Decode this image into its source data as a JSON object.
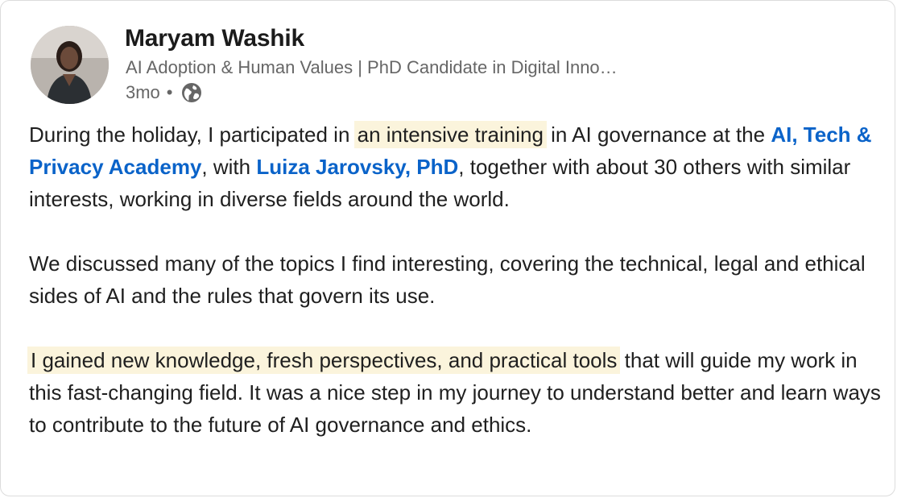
{
  "author": {
    "name": "Maryam Washik",
    "headline": "AI Adoption & Human Values | PhD Candidate in Digital Inno…",
    "time": "3mo",
    "separator": "•",
    "visibility_icon": "globe-icon"
  },
  "post": {
    "p1": {
      "t1": "During the holiday, I participated in ",
      "hl1": "an intensive training",
      "t2": " in AI governance at the ",
      "mention1": "AI, Tech & Privacy Academy",
      "t3": ", with ",
      "mention2": "Luiza Jarovsky, PhD",
      "t4": ", together with about 30 others with similar interests, working in diverse fields around the world."
    },
    "p2": "We discussed many of the topics I find interesting, covering the technical, legal and ethical sides of AI and the rules that govern its use.",
    "p3": {
      "hl1": "I gained new knowledge, fresh perspectives, and practical tools",
      "t1": " that will guide my work in this fast-changing field. It was a nice step in my journey to understand better and learn ways to contribute to the future of AI governance and ethics."
    }
  },
  "colors": {
    "mention": "#0a63c9",
    "highlight": "#fbf4dc",
    "meta_text": "#666666"
  }
}
